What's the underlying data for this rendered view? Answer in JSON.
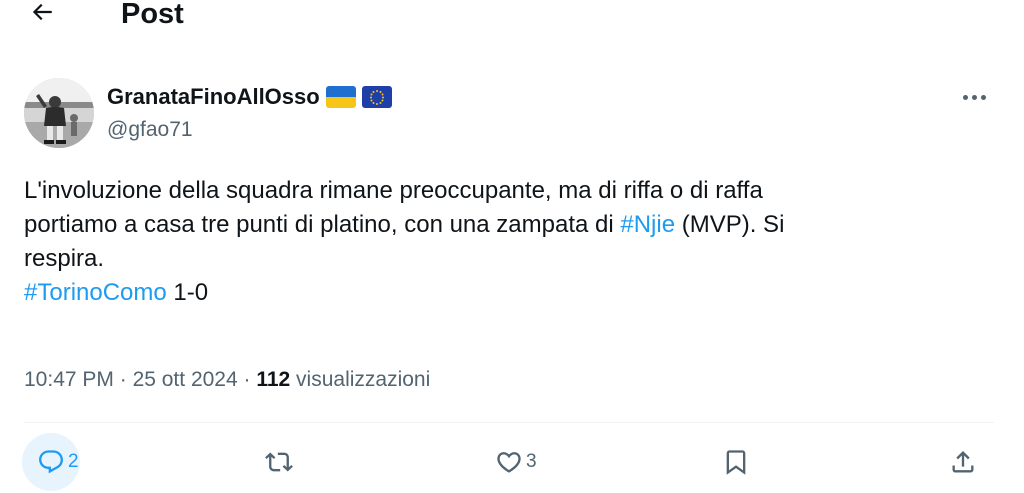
{
  "header": {
    "title": "Post"
  },
  "author": {
    "display_name": "GranataFinoAllOsso",
    "handle": "@gfao71",
    "flags": [
      "ukraine-flag",
      "eu-flag"
    ]
  },
  "tweet": {
    "line1": "L'involuzione della squadra rimane preoccupante, ma di riffa o di raffa",
    "line2_pre": "portiamo a casa tre punti di platino, con una zampata di ",
    "hashtag1": "#Njie",
    "line2_post": " (MVP). Si",
    "line3": "respira.",
    "hashtag2": "#TorinoComo",
    "score": " 1-0"
  },
  "meta": {
    "time": "10:47 PM",
    "sep1": " · ",
    "date": "25 ott 2024",
    "sep2": " · ",
    "views_count": "112",
    "views_label": " visualizzazioni"
  },
  "actions": {
    "reply_count": "2",
    "retweet_count": "",
    "like_count": "3"
  },
  "colors": {
    "accent": "#1d9bf0",
    "text": "#0f1419",
    "secondary": "#536471"
  }
}
